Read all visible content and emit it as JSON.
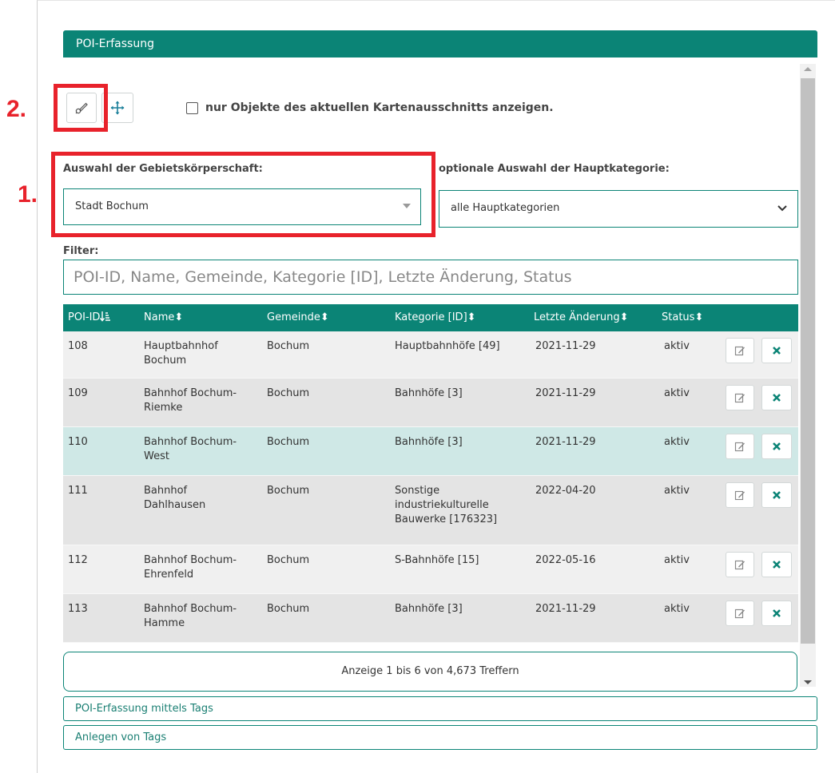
{
  "panel": {
    "title": "POI-Erfassung"
  },
  "annotations": {
    "step1": "1.",
    "step2": "2."
  },
  "toolbar": {
    "edit_icon": "pencil-pin-icon",
    "move_icon": "move-arrows-icon",
    "visible_only_label": "nur Objekte des aktuellen Kartenausschnitts anzeigen.",
    "visible_only_checked": false
  },
  "filters": {
    "authority_label": "Auswahl der Gebietskörperschaft:",
    "authority_value": "Stadt Bochum",
    "category_label": "optionale Auswahl der Hauptkategorie:",
    "category_value": "alle Hauptkategorien",
    "filter_label": "Filter:",
    "filter_placeholder": "POI-ID, Name, Gemeinde, Kategorie [ID], Letzte Änderung, Status"
  },
  "table": {
    "headers": [
      "POI-ID",
      "Name",
      "Gemeinde",
      "Kategorie [ID]",
      "Letzte Änderung",
      "Status"
    ],
    "rows": [
      {
        "id": "108",
        "name": [
          "Hauptbahnhof",
          "Bochum"
        ],
        "gemeinde": "Bochum",
        "kategorie": [
          "Hauptbahnhöfe [49]"
        ],
        "datum": "2021-11-29",
        "status": "aktiv"
      },
      {
        "id": "109",
        "name": [
          "Bahnhof Bochum-",
          "Riemke"
        ],
        "gemeinde": "Bochum",
        "kategorie": [
          "Bahnhöfe [3]"
        ],
        "datum": "2021-11-29",
        "status": "aktiv"
      },
      {
        "id": "110",
        "name": [
          "Bahnhof Bochum-",
          "West"
        ],
        "gemeinde": "Bochum",
        "kategorie": [
          "Bahnhöfe [3]"
        ],
        "datum": "2021-11-29",
        "status": "aktiv",
        "highlighted": true
      },
      {
        "id": "111",
        "name": [
          "Bahnhof",
          "Dahlhausen"
        ],
        "gemeinde": "Bochum",
        "kategorie": [
          "Sonstige",
          "industriekulturelle",
          "Bauwerke [176323]"
        ],
        "datum": "2022-04-20",
        "status": "aktiv"
      },
      {
        "id": "112",
        "name": [
          "Bahnhof Bochum-",
          "Ehrenfeld"
        ],
        "gemeinde": "Bochum",
        "kategorie": [
          "S-Bahnhöfe [15]"
        ],
        "datum": "2022-05-16",
        "status": "aktiv"
      },
      {
        "id": "113",
        "name": [
          "Bahnhof Bochum-",
          "Hamme"
        ],
        "gemeinde": "Bochum",
        "kategorie": [
          "Bahnhöfe [3]"
        ],
        "datum": "2021-11-29",
        "status": "aktiv"
      }
    ],
    "row_colors": {
      "odd": "#f0f0f0",
      "even": "#e4e4e4",
      "highlight": "#cfe8e6"
    }
  },
  "paging": {
    "info": "Anzeige 1 bis 6 von 4,673 Treffern"
  },
  "accordion": {
    "item1": "POI-Erfassung mittels Tags",
    "item2": "Anlegen von Tags"
  },
  "colors": {
    "accent": "#0b8476",
    "annotation": "#e8222b"
  }
}
